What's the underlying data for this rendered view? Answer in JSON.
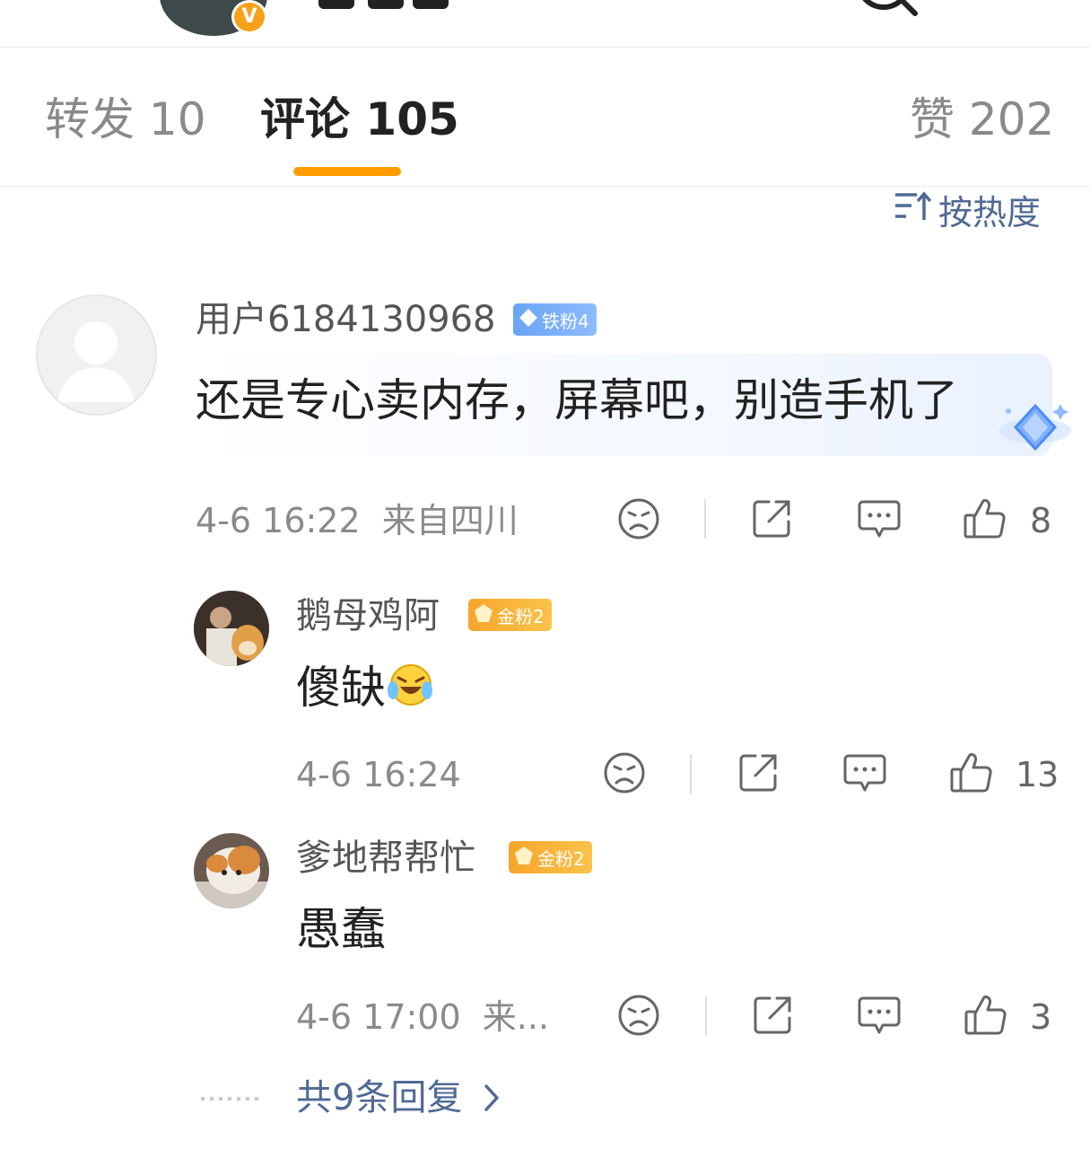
{
  "tabs": [
    {
      "label": "转发 10"
    },
    {
      "label": "评论 105"
    },
    {
      "label": "赞 202"
    }
  ],
  "sort": {
    "label": "按热度"
  },
  "comment": {
    "username": "用户6184130968",
    "badge": "铁粉4",
    "text": "还是专心卖内存，屏幕吧，别造手机了",
    "time": "4-6 16:22",
    "location": "来自四川",
    "likes": "8"
  },
  "replies": [
    {
      "username": "鹅母鸡阿",
      "badge": "金粉2",
      "text": "傻缺",
      "emoji": "laugh-cry-icon",
      "time": "4-6 16:24",
      "location": "",
      "likes": "13"
    },
    {
      "username": "爹地帮帮忙",
      "badge": "金粉2",
      "text": "愚蠢",
      "time": "4-6 17:00",
      "location": "来...",
      "likes": "3"
    }
  ],
  "more_replies": {
    "label": "共9条回复"
  },
  "colors": {
    "accent": "#ff9d00",
    "link": "#4f6a94",
    "iron_badge": "#6aa4f6",
    "gold_badge": "#f7a52b"
  }
}
